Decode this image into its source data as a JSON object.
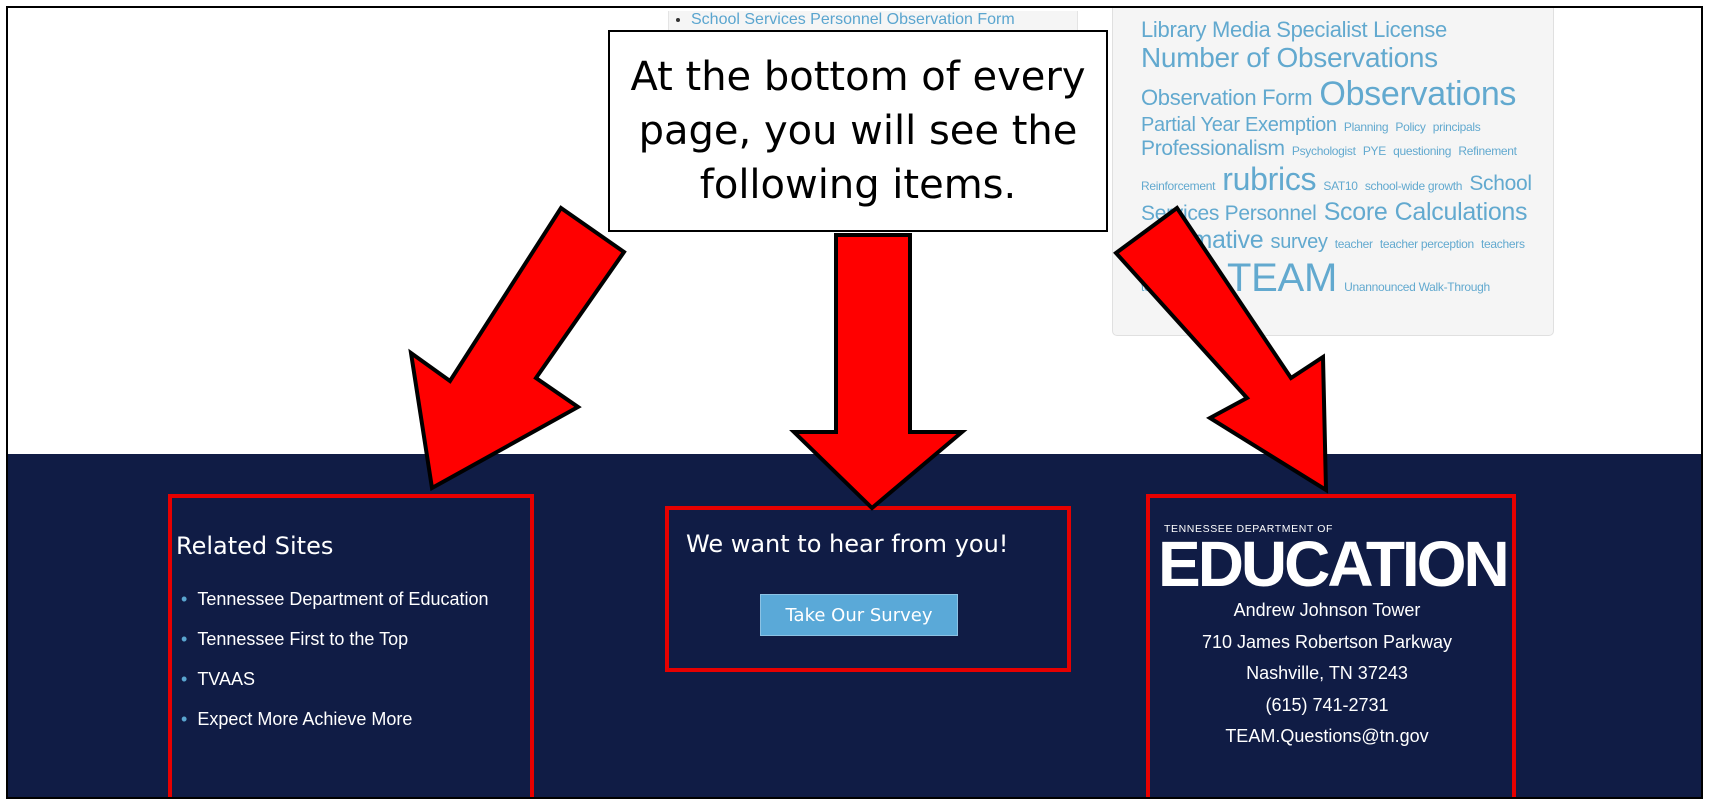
{
  "top_list": {
    "item": "School Services Personnel Observation Form"
  },
  "tag_cloud": [
    {
      "t": "Library Media Specialist License",
      "s": 22
    },
    {
      "t": "Number of Observations",
      "s": 28
    },
    {
      "t": "Observation Form",
      "s": 22
    },
    {
      "t": "Observations",
      "s": 34
    },
    {
      "t": "Partial Year Exemption",
      "s": 20
    },
    {
      "t": "Planning",
      "s": 12
    },
    {
      "t": "Policy",
      "s": 12
    },
    {
      "t": "principals",
      "s": 12
    },
    {
      "t": "Professionalism",
      "s": 21
    },
    {
      "t": "Psychologist",
      "s": 12
    },
    {
      "t": "PYE",
      "s": 12
    },
    {
      "t": "questioning",
      "s": 12
    },
    {
      "t": "Refinement",
      "s": 12
    },
    {
      "t": "Reinforcement",
      "s": 12
    },
    {
      "t": "rubrics",
      "s": 32
    },
    {
      "t": "SAT10",
      "s": 12
    },
    {
      "t": "school-wide growth",
      "s": 12
    },
    {
      "t": "School Services Personnel",
      "s": 21
    },
    {
      "t": "Score",
      "s": 25
    },
    {
      "t": "Calculations",
      "s": 25
    },
    {
      "t": "Summative",
      "s": 25
    },
    {
      "t": "survey",
      "s": 20
    },
    {
      "t": "teacher",
      "s": 12
    },
    {
      "t": "teacher perception",
      "s": 12
    },
    {
      "t": "teachers",
      "s": 12
    },
    {
      "t": "teacher support",
      "s": 12
    },
    {
      "t": "TEAM",
      "s": 40
    },
    {
      "t": "Unannounced Walk-Through",
      "s": 12
    }
  ],
  "callout": {
    "text": "At the bottom of every page, you will see the following items."
  },
  "footer": {
    "related": {
      "title": "Related Sites",
      "links": [
        "Tennessee Department of Education",
        "Tennessee First to the Top",
        "TVAAS",
        "Expect More Achieve More"
      ]
    },
    "survey": {
      "title": "We want to hear from you!",
      "button": "Take Our Survey"
    },
    "contact": {
      "dept_line": "TENNESSEE DEPARTMENT OF",
      "logo_word": "EDUCATION",
      "address": [
        "Andrew Johnson Tower",
        "710 James Robertson Parkway",
        "Nashville, TN 37243",
        "(615) 741-2731",
        "TEAM.Questions@tn.gov"
      ]
    }
  },
  "colors": {
    "footer_bg": "#101c45",
    "link_blue": "#5aa5cf",
    "highlight_red": "#e60000",
    "button_bg": "#5aa9d8"
  }
}
